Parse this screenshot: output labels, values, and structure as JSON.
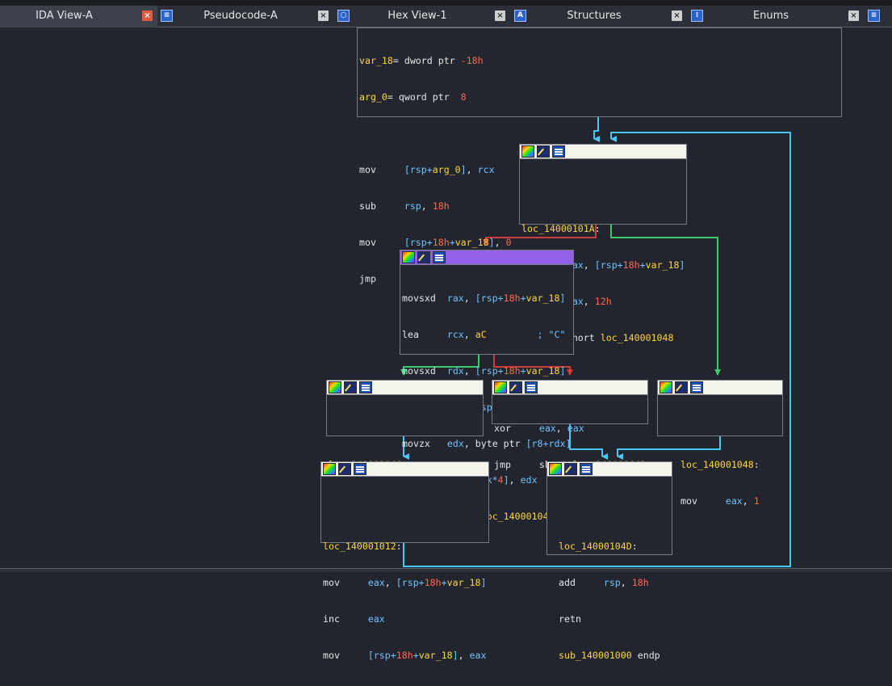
{
  "tabs": [
    {
      "label": "IDA View-A",
      "active": true,
      "icon": "graph-view-icon"
    },
    {
      "label": "Pseudocode-A",
      "active": false,
      "icon": "hex-view-icon"
    },
    {
      "label": "Hex View-1",
      "active": false,
      "icon": "structures-icon"
    },
    {
      "label": "Structures",
      "active": false,
      "icon": "enums-icon"
    },
    {
      "label": "Enums",
      "active": false,
      "icon": "imports-icon"
    }
  ],
  "colors": {
    "background": "#22252e",
    "node_header": "#f4f4ec",
    "node_header_selected": "#9460e8",
    "edge_true": "#3cc86c",
    "edge_false": "#d03c3c",
    "edge_unconditional": "#48c8f0",
    "register": "#6ec3ff",
    "number": "#ff6a4e",
    "label": "#ffd63a"
  },
  "blocks": {
    "entry": [
      "var_18= dword ptr -18h",
      "arg_0= qword ptr  8",
      "",
      "mov     [rsp+arg_0], rcx",
      "sub     rsp, 18h",
      "mov     [rsp+18h+var_18], 0",
      "jmp     short loc_14000101A"
    ],
    "loc_14000101A": [
      "",
      "loc_14000101A:",
      "movsxd  rax, [rsp+18h+var_18]",
      "cmp     rax, 12h",
      "jnb     short loc_140001048"
    ],
    "compare_block": [
      "movsxd  rax, [rsp+18h+var_18]",
      "lea     rcx, aC         ; \"C\"",
      "movsxd  rdx, [rsp+18h+var_18]",
      "mov     r8, [rsp+18h+arg_0]",
      "movzx   edx, byte ptr [r8+rdx]",
      "cmp     [rcx+rax*4], edx",
      "jz      short loc_140001046"
    ],
    "loc_140001046": [
      "",
      "loc_140001046:",
      "jmp     short loc_140001012"
    ],
    "xor_block": [
      "xor     eax, eax",
      "jmp     short loc_14000104D"
    ],
    "loc_140001048": [
      "",
      "loc_140001048:",
      "mov     eax, 1"
    ],
    "loc_140001012": [
      "",
      "loc_140001012:",
      "mov     eax, [rsp+18h+var_18]",
      "inc     eax",
      "mov     [rsp+18h+var_18], eax"
    ],
    "loc_14000104D": [
      "",
      "loc_14000104D:",
      "add     rsp, 18h",
      "retn",
      "sub_140001000 endp"
    ]
  }
}
